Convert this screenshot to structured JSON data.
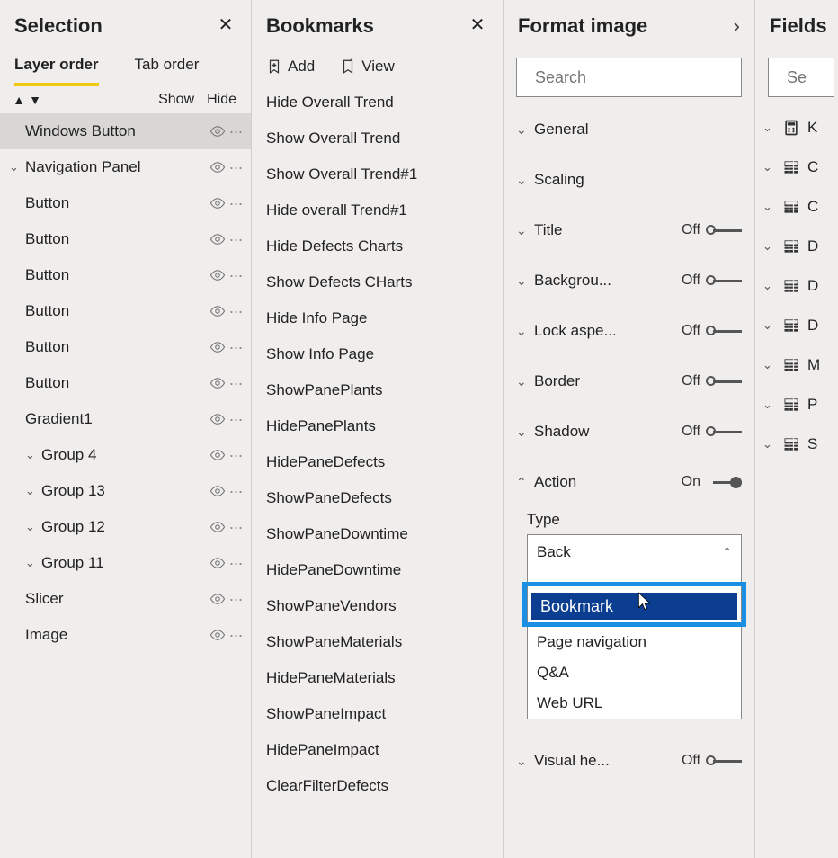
{
  "selection": {
    "title": "Selection",
    "tabs": {
      "layer": "Layer order",
      "tab": "Tab order"
    },
    "toolbar": {
      "show": "Show",
      "hide": "Hide"
    },
    "items": [
      {
        "label": "Windows Button",
        "chevron": false,
        "indent": 0,
        "selected": true
      },
      {
        "label": "Navigation Panel",
        "chevron": true,
        "indent": 0,
        "selected": false
      },
      {
        "label": "Button",
        "chevron": false,
        "indent": 0,
        "selected": false
      },
      {
        "label": "Button",
        "chevron": false,
        "indent": 0,
        "selected": false
      },
      {
        "label": "Button",
        "chevron": false,
        "indent": 0,
        "selected": false
      },
      {
        "label": "Button",
        "chevron": false,
        "indent": 0,
        "selected": false
      },
      {
        "label": "Button",
        "chevron": false,
        "indent": 0,
        "selected": false
      },
      {
        "label": "Button",
        "chevron": false,
        "indent": 0,
        "selected": false
      },
      {
        "label": "Gradient1",
        "chevron": false,
        "indent": 0,
        "selected": false
      },
      {
        "label": "Group 4",
        "chevron": true,
        "indent": 1,
        "selected": false
      },
      {
        "label": "Group 13",
        "chevron": true,
        "indent": 1,
        "selected": false
      },
      {
        "label": "Group 12",
        "chevron": true,
        "indent": 1,
        "selected": false
      },
      {
        "label": "Group 11",
        "chevron": true,
        "indent": 1,
        "selected": false
      },
      {
        "label": "Slicer",
        "chevron": false,
        "indent": 0,
        "selected": false
      },
      {
        "label": "Image",
        "chevron": false,
        "indent": 0,
        "selected": false
      }
    ]
  },
  "bookmarks": {
    "title": "Bookmarks",
    "toolbar": {
      "add": "Add",
      "view": "View"
    },
    "items": [
      "Hide Overall Trend",
      "Show Overall Trend",
      "Show Overall Trend#1",
      "Hide overall Trend#1",
      "Hide Defects Charts",
      "Show Defects CHarts",
      "Hide Info Page",
      "Show Info Page",
      "ShowPanePlants",
      "HidePanePlants",
      "HidePaneDefects",
      "ShowPaneDefects",
      "ShowPaneDowntime",
      "HidePaneDowntime",
      "ShowPaneVendors",
      "ShowPaneMaterials",
      "HidePaneMaterials",
      "ShowPaneImpact",
      "HidePaneImpact",
      "ClearFilterDefects"
    ]
  },
  "format": {
    "title": "Format image",
    "search_placeholder": "Search",
    "rows": [
      {
        "label": "General",
        "state": "",
        "expanded": false
      },
      {
        "label": "Scaling",
        "state": "",
        "expanded": false
      },
      {
        "label": "Title",
        "state": "Off",
        "expanded": false
      },
      {
        "label": "Backgrou...",
        "state": "Off",
        "expanded": false
      },
      {
        "label": "Lock aspe...",
        "state": "Off",
        "expanded": false
      },
      {
        "label": "Border",
        "state": "Off",
        "expanded": false
      },
      {
        "label": "Shadow",
        "state": "Off",
        "expanded": false
      },
      {
        "label": "Action",
        "state": "On",
        "expanded": true
      }
    ],
    "type_label": "Type",
    "type_selected": "Back",
    "type_options": [
      "Back",
      "Bookmark",
      "Page navigation",
      "Q&A",
      "Web URL"
    ],
    "type_hover": "Bookmark",
    "visual_header": {
      "label": "Visual he...",
      "state": "Off"
    }
  },
  "fields": {
    "title": "Fields",
    "search_placeholder": "Se",
    "items": [
      {
        "icon": "calc",
        "label": "K"
      },
      {
        "icon": "table",
        "label": "C"
      },
      {
        "icon": "table",
        "label": "C"
      },
      {
        "icon": "table",
        "label": "D"
      },
      {
        "icon": "table",
        "label": "D"
      },
      {
        "icon": "table",
        "label": "D"
      },
      {
        "icon": "table",
        "label": "M"
      },
      {
        "icon": "table",
        "label": "P"
      },
      {
        "icon": "table",
        "label": "S"
      }
    ]
  }
}
